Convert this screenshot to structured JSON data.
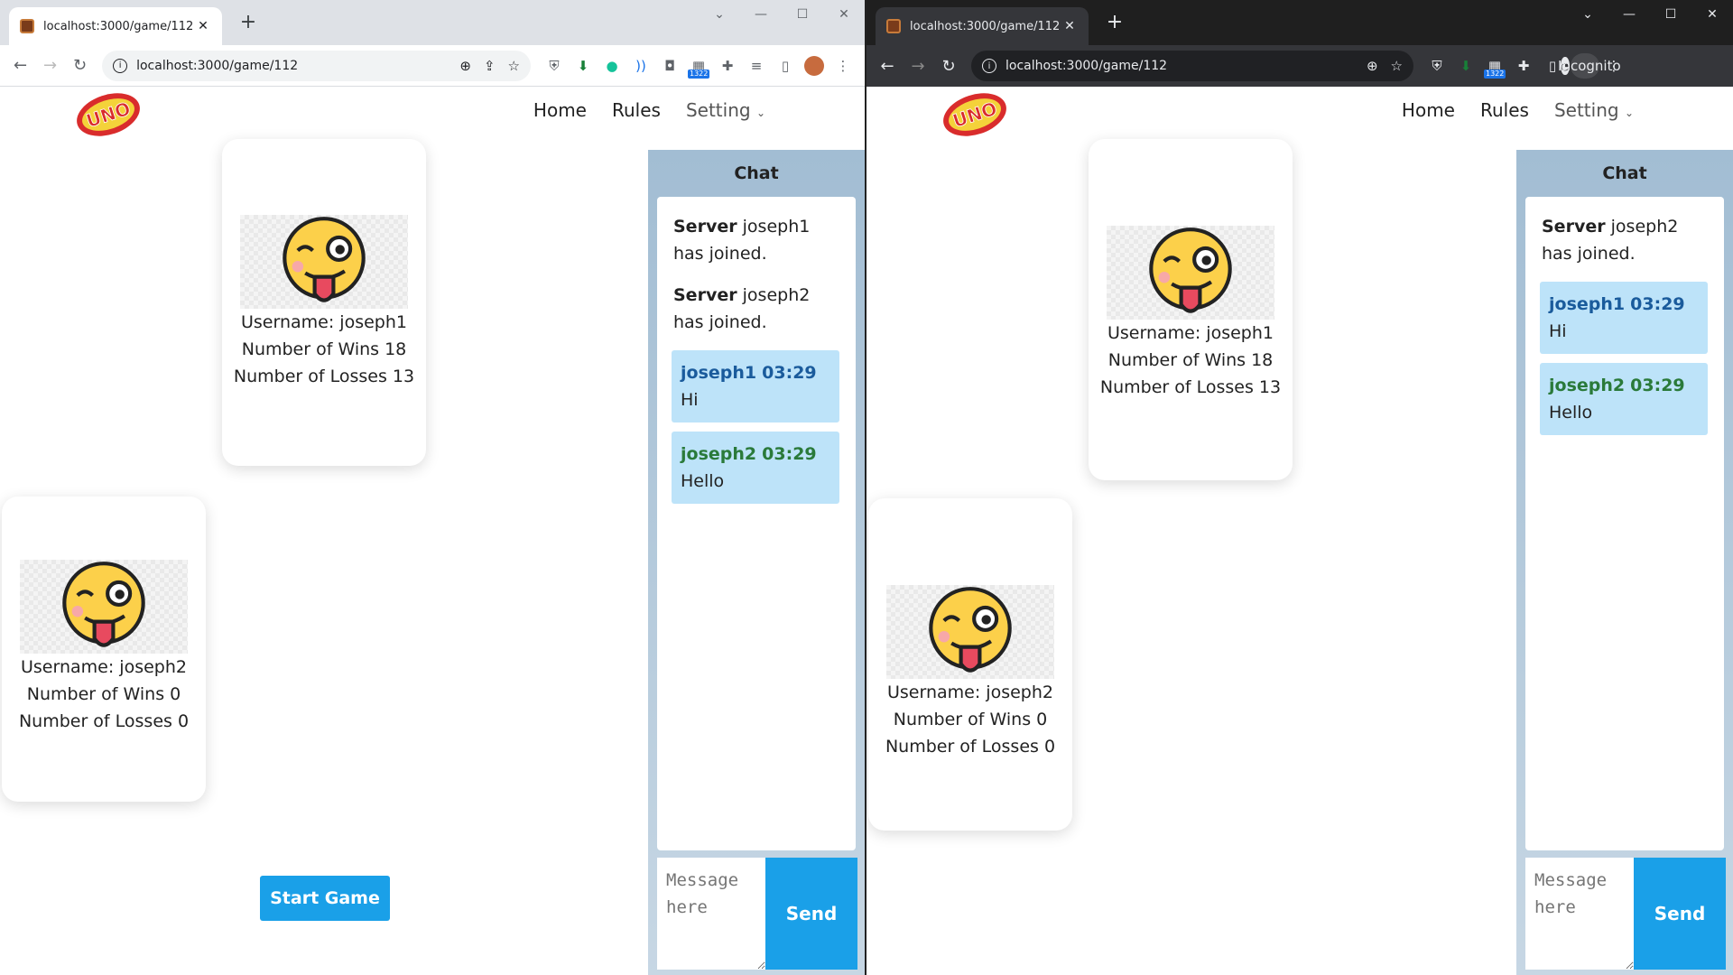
{
  "browser_left": {
    "tab_title": "localhost:3000/game/112",
    "url": "localhost:3000/game/112",
    "ext_badge": "1322"
  },
  "browser_right": {
    "tab_title": "localhost:3000/game/112",
    "url": "localhost:3000/game/112",
    "ext_badge": "1322",
    "incognito_label": "Incognito"
  },
  "site": {
    "logo_text": "UNO",
    "nav": {
      "home": "Home",
      "rules": "Rules",
      "setting": "Setting"
    }
  },
  "players": {
    "p1": {
      "username": "Username: joseph1",
      "wins": "Number of Wins 18",
      "losses": "Number of Losses 13"
    },
    "p2": {
      "username": "Username: joseph2",
      "wins": "Number of Wins 0",
      "losses": "Number of Losses 0"
    }
  },
  "game": {
    "start_label": "Start Game"
  },
  "chat": {
    "title": "Chat",
    "server_label": "Server",
    "joined_joseph1": "joseph1 has joined.",
    "joined_joseph2": "joseph2 has joined.",
    "msg1": {
      "user": "joseph1",
      "time": "03:29",
      "text": "Hi"
    },
    "msg2": {
      "user": "joseph2",
      "time": "03:29",
      "text": "Hello"
    },
    "input_placeholder": "Message here",
    "send_label": "Send"
  },
  "colors": {
    "accent": "#1aa0e8",
    "bubble": "#bde3f9",
    "user1": "#1a5b9c",
    "user2": "#2a7a3a"
  }
}
